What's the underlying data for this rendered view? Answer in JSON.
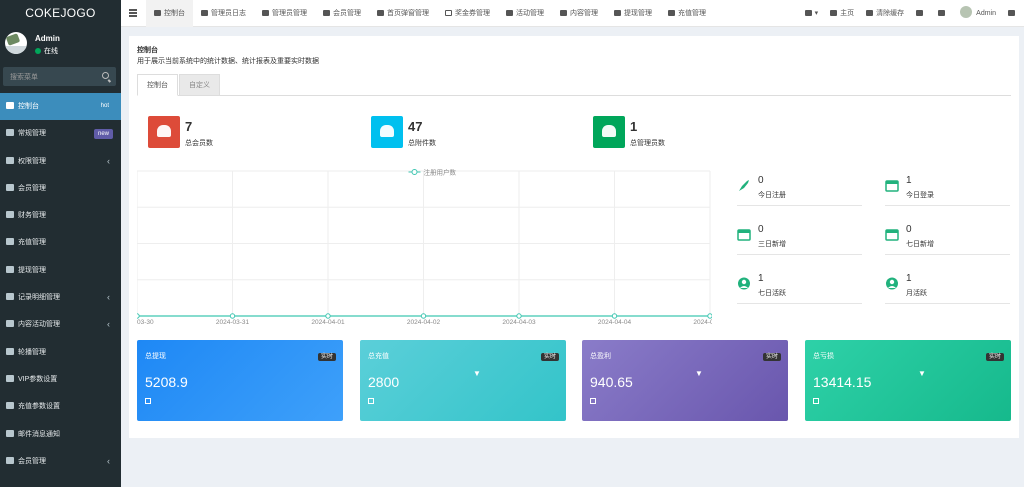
{
  "app": {
    "logo": "COKEJOGO"
  },
  "user": {
    "name": "Admin",
    "status": "在线"
  },
  "search": {
    "placeholder": "搜索菜单"
  },
  "menu": [
    {
      "label": "控制台",
      "badge": "hot",
      "active": true
    },
    {
      "label": "常规管理",
      "badge": "new"
    },
    {
      "label": "权限管理",
      "chevron": true
    },
    {
      "label": "会员管理"
    },
    {
      "label": "财务管理"
    },
    {
      "label": "充值管理"
    },
    {
      "label": "提现管理"
    },
    {
      "label": "记录明细管理",
      "chevron": true
    },
    {
      "label": "内容活动管理",
      "chevron": true
    },
    {
      "label": "轮播管理"
    },
    {
      "label": "VIP参数设置"
    },
    {
      "label": "充值参数设置"
    },
    {
      "label": "邮件消息通知"
    },
    {
      "label": "会员管理",
      "chevron": true
    }
  ],
  "topbar": {
    "tabs": [
      "控制台",
      "管理员日志",
      "管理员管理",
      "会员管理",
      "首页弹窗管理",
      "奖金券管理",
      "活动管理",
      "内容管理",
      "提现管理",
      "充值管理"
    ],
    "home": "主页",
    "clear_cache": "清除缓存",
    "admin": "Admin"
  },
  "panel": {
    "title": "控制台",
    "subtitle": "用于展示当前系统中的统计数据、统计报表及重要实时数据",
    "tabs": [
      "控制台",
      "自定义"
    ]
  },
  "stats": [
    {
      "value": "7",
      "label": "总会员数",
      "color": "#dd4b39"
    },
    {
      "value": "47",
      "label": "总附件数",
      "color": "#00c0ef"
    },
    {
      "value": "1",
      "label": "总管理员数",
      "color": "#00a65a"
    }
  ],
  "mini_stats": [
    {
      "value": "0",
      "label": "今日注册",
      "icon": "rocket-icon"
    },
    {
      "value": "1",
      "label": "今日登录",
      "icon": "id-card-icon"
    },
    {
      "value": "0",
      "label": "三日新增",
      "icon": "calendar-icon"
    },
    {
      "value": "0",
      "label": "七日新增",
      "icon": "calendar-plus-icon"
    },
    {
      "value": "1",
      "label": "七日活跃",
      "icon": "user-circle-icon"
    },
    {
      "value": "1",
      "label": "月活跃",
      "icon": "user-circle-icon"
    }
  ],
  "cards": [
    {
      "title": "总提现",
      "badge": "实时",
      "value": "5208.9",
      "filter": "",
      "from": "#1e88f5",
      "to": "#3ea0fa"
    },
    {
      "title": "总充值",
      "badge": "实时",
      "value": "2800",
      "filter": "▼",
      "from": "#5bcfd9",
      "to": "#33c4c9"
    },
    {
      "title": "总盈利",
      "badge": "实时",
      "value": "940.65",
      "filter": "▼",
      "from": "#8a7cc9",
      "to": "#6956ad"
    },
    {
      "title": "总亏损",
      "badge": "实时",
      "value": "13414.15",
      "filter": "▼",
      "from": "#2ed1a8",
      "to": "#16b98c"
    }
  ],
  "chart_data": {
    "type": "line",
    "categories": [
      "2024-03-30",
      "2024-03-31",
      "2024-04-01",
      "2024-04-02",
      "2024-04-03",
      "2024-04-04",
      "2024-04-05"
    ],
    "series": [
      {
        "name": "注册用户数",
        "values": [
          0,
          0,
          0,
          0,
          0,
          0,
          0
        ],
        "color": "#3ec6b1"
      }
    ],
    "grid": true,
    "legend": "top"
  }
}
